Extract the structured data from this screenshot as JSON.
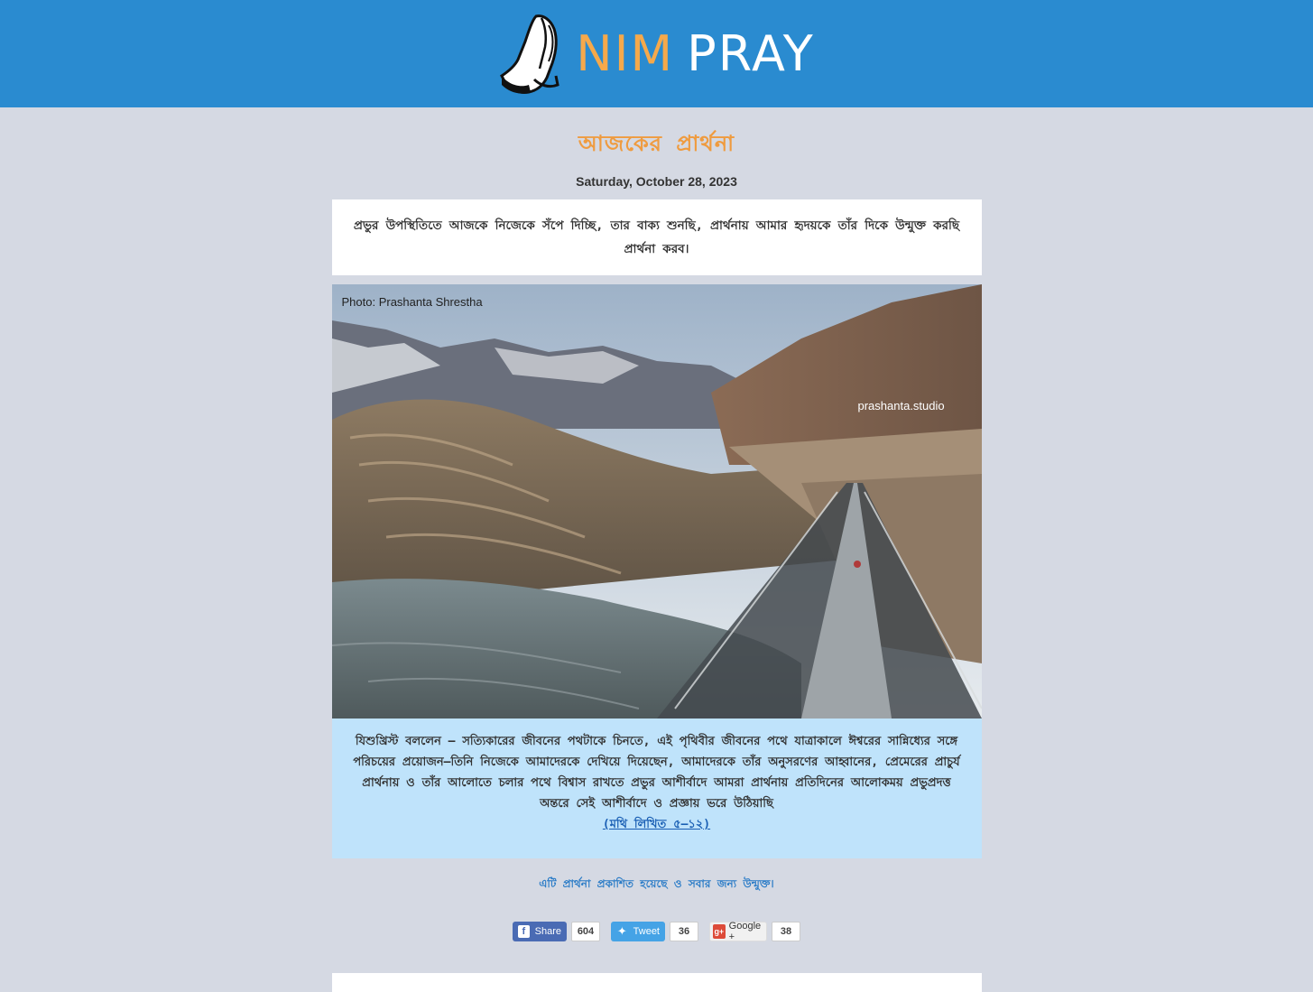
{
  "brand": {
    "name_part1": "NIM",
    "name_part2": "PRAY"
  },
  "page": {
    "title": "আজকের প্রার্থনা",
    "date": "Saturday, October 28, 2023",
    "intro": "প্রভুর উপস্থিতিতে আজকে নিজেকে সঁপে দিচ্ছি, তার বাক্য শুনছি, প্রার্থনায় আমার হৃদয়কে তাঁর দিকে উন্মুক্ত করছি প্রার্থনা করব।"
  },
  "photo": {
    "credit": "Photo: Prashanta Shrestha",
    "watermark": "prashanta.studio"
  },
  "verse": {
    "text": "যিশুখ্রিস্ট বললেন – সত্যিকারের জীবনের পথটাকে চিনতে, এই পৃথিবীর জীবনের পথে যাত্রাকালে ঈশ্বরের সান্নিধ্যের সঙ্গে পরিচয়ের প্রয়োজন—তিনি নিজেকে আমাদেরকে দেখিয়ে দিয়েছেন, আমাদেরকে তাঁর অনুসরণের আহ্বানের, প্রেমেরের প্রাচুর্য প্রার্থনায় ও তাঁর আলোতে চলার পথে বিশ্বাস রাখতে প্রভুর আশীর্বাদে আমরা প্রার্থনায় প্রতিদিনের আলোকময় প্রভুপ্রদত্ত অন্তরে সেই আশীর্বাদে ও প্রজ্ঞায় ভরে উঠিয়াছি",
    "reference": "(মথি লিখিত ৫–১২)"
  },
  "footer": {
    "note": "এটি প্রার্থনা প্রকাশিত হয়েছে ও সবার জন্য উন্মুক্ত।"
  },
  "share": {
    "facebook": {
      "label": "Share",
      "count": "604"
    },
    "twitter": {
      "label": "Tweet",
      "count": "36"
    },
    "google": {
      "label": "Google +",
      "count": "38"
    }
  },
  "colors": {
    "header": "#2a8bd0",
    "background": "#d5d9e3",
    "title": "#ef9b3f",
    "verse_bg": "#bfe3fb"
  }
}
